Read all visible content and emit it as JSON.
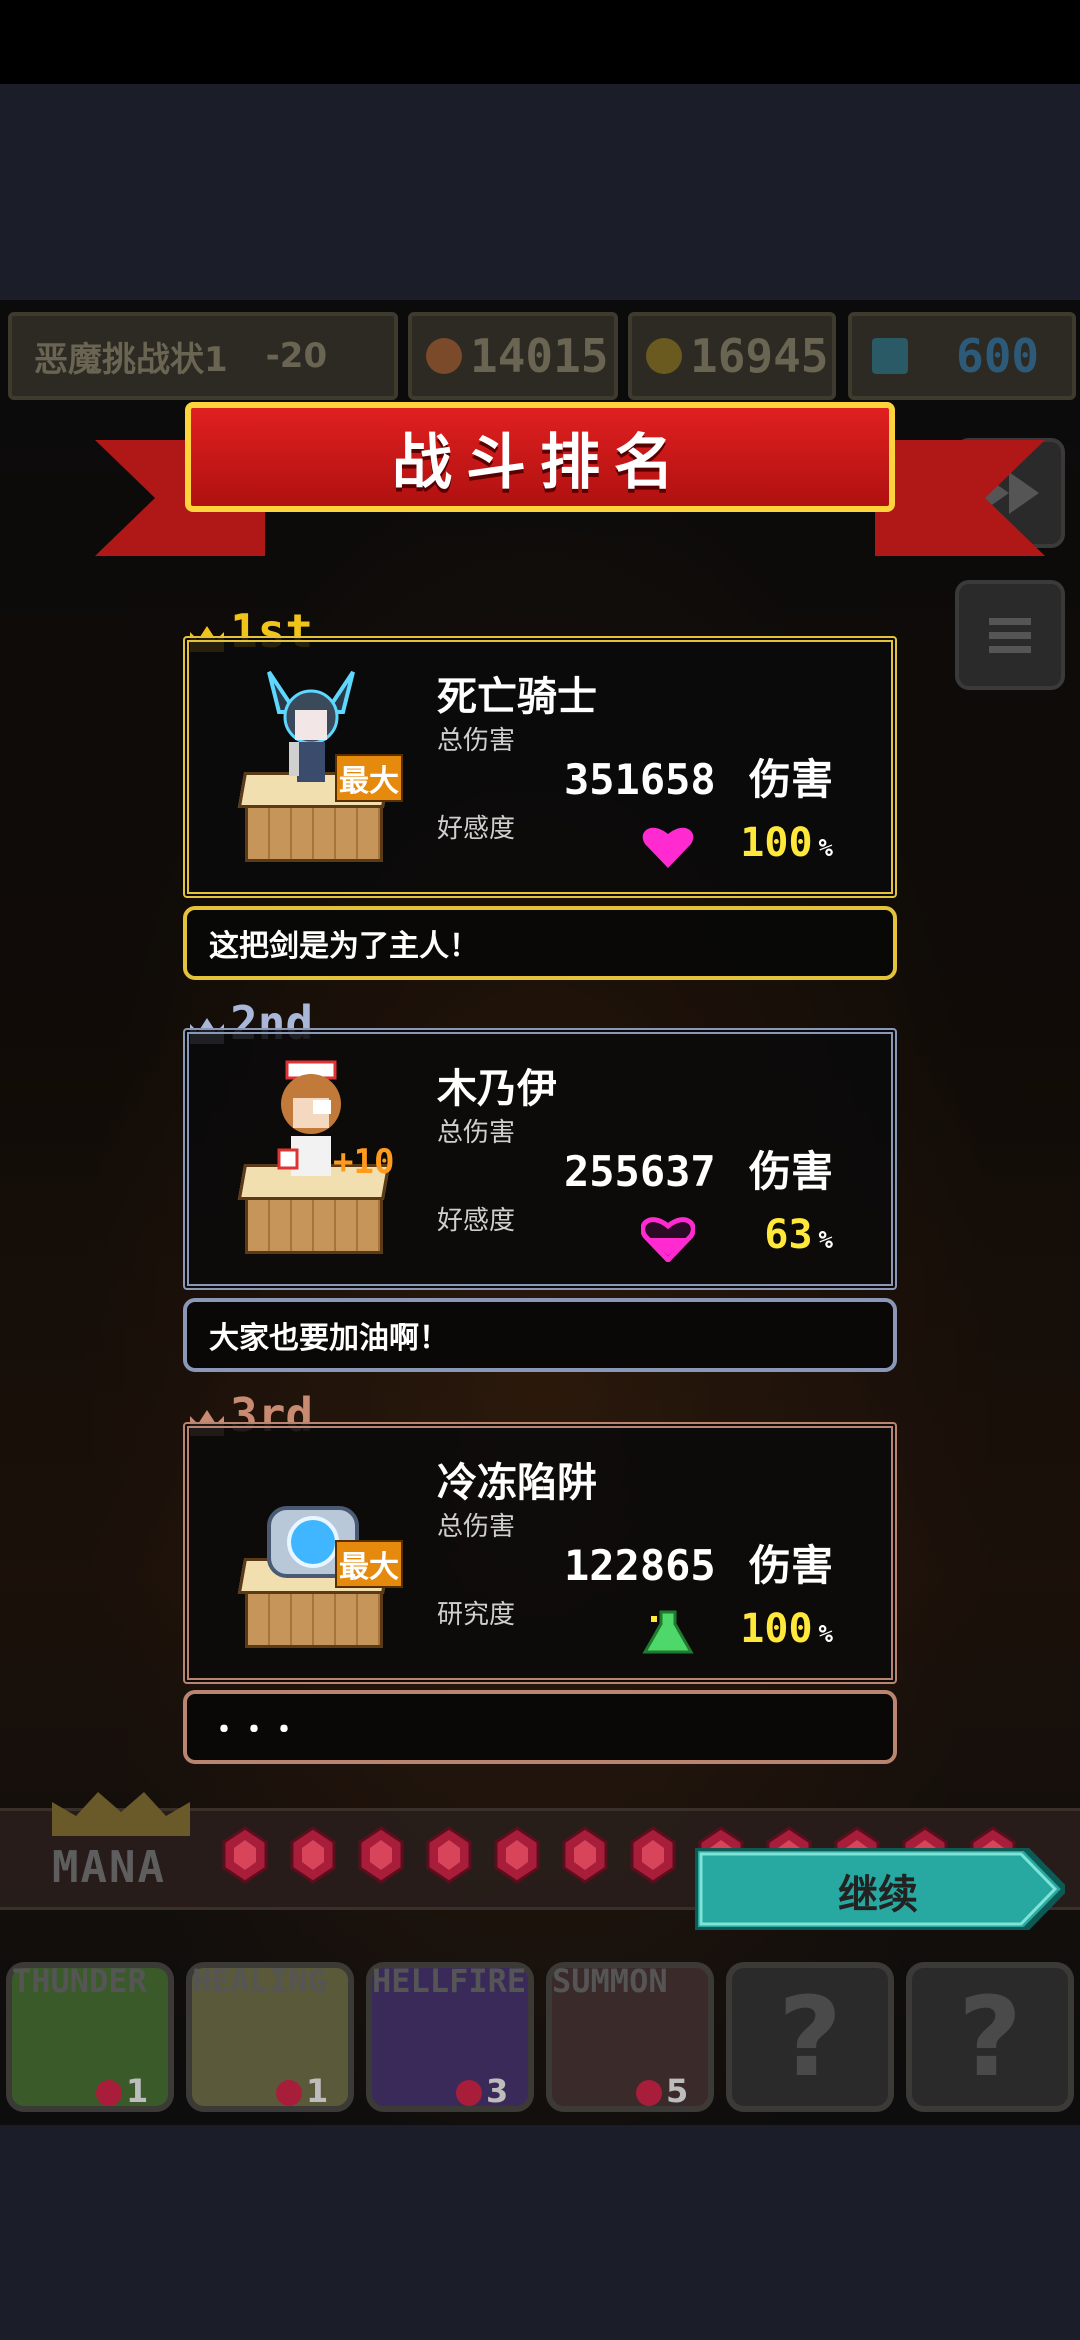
{
  "hud": {
    "stage_name": "恶魔挑战状1",
    "stage_mod": "-20",
    "coins": "14015",
    "gold": "16945",
    "gems": "600"
  },
  "banner": {
    "title": "战斗排名"
  },
  "ranking": [
    {
      "rank": "1st",
      "name": "死亡骑士",
      "damage_label": "总伤害",
      "damage": "351658",
      "damage_unit": "伤害",
      "affinity_label": "好感度",
      "affinity": "100",
      "affinity_unit": "%",
      "badge": "最大",
      "quote": "这把剑是为了主人！",
      "icon": "heart-icon",
      "heart_color": "#ff2ad0"
    },
    {
      "rank": "2nd",
      "name": "木乃伊",
      "damage_label": "总伤害",
      "damage": "255637",
      "damage_unit": "伤害",
      "affinity_label": "好感度",
      "affinity": "63",
      "affinity_unit": "%",
      "badge": "+10",
      "quote": "大家也要加油啊！",
      "icon": "heart-icon",
      "heart_color": "#ff2ad0"
    },
    {
      "rank": "3rd",
      "name": "冷冻陷阱",
      "damage_label": "总伤害",
      "damage": "122865",
      "damage_unit": "伤害",
      "affinity_label": "研究度",
      "affinity": "100",
      "affinity_unit": "%",
      "badge": "最大",
      "quote": "・・・",
      "icon": "potion-icon",
      "heart_color": "#4fd86a"
    }
  ],
  "mana": {
    "label": "MANA"
  },
  "continue_label": "继续",
  "skills": [
    {
      "name": "THUNDER",
      "cost": "1"
    },
    {
      "name": "HEALING",
      "cost": "1"
    },
    {
      "name": "HELLFIRE",
      "cost": "3"
    },
    {
      "name": "SUMMON",
      "cost": "5"
    },
    {
      "name": "",
      "cost": "",
      "locked_label": "?"
    },
    {
      "name": "",
      "cost": "",
      "locked_label": "?"
    }
  ],
  "colors": {
    "banner_red": "#d01a1a",
    "gold_frame": "#e4c23a",
    "silver_frame": "#8a97b6",
    "bronze_frame": "#b98570",
    "continue_teal": "#27a8a0",
    "affinity_text": "#ffe83a"
  }
}
